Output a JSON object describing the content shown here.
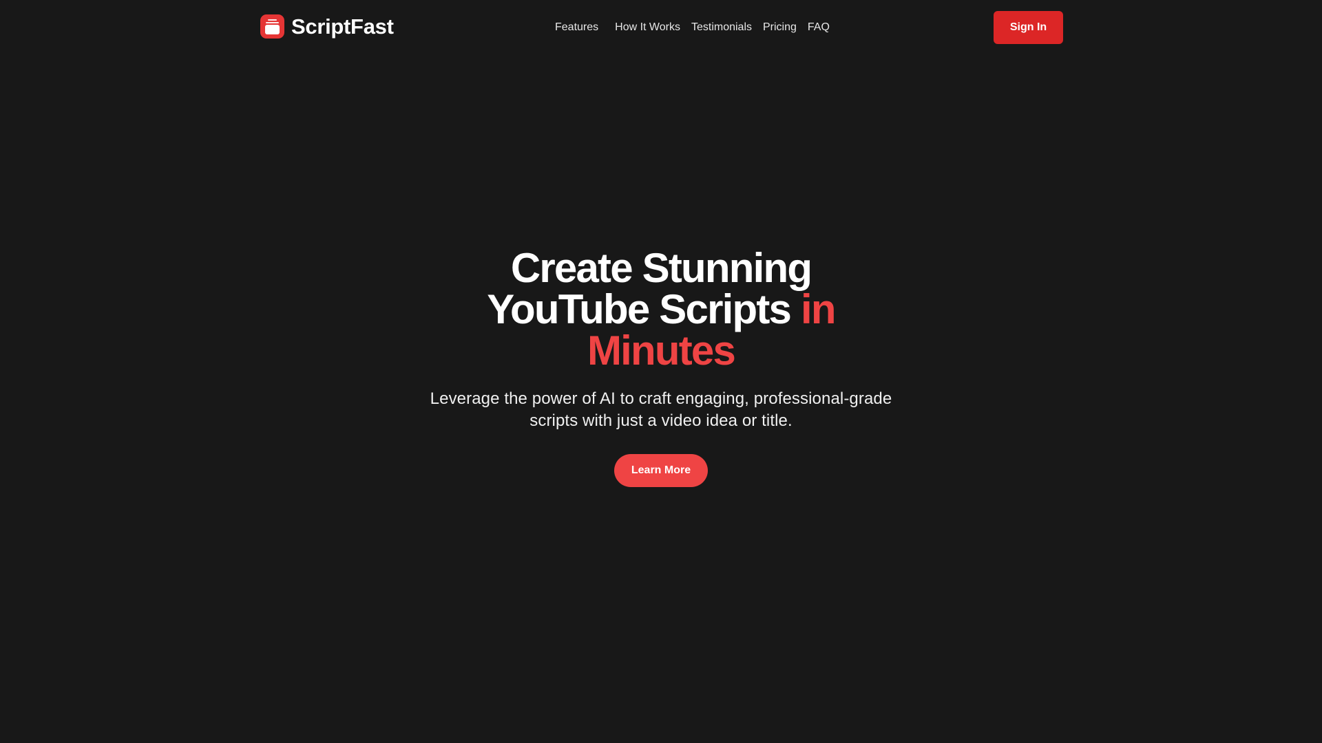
{
  "header": {
    "brand": {
      "name": "ScriptFast",
      "logo_icon": "stacked-cards-icon",
      "logo_color": "#e53535"
    },
    "nav": [
      {
        "label": "Features"
      },
      {
        "label": "How It Works"
      },
      {
        "label": "Testimonials"
      },
      {
        "label": "Pricing"
      },
      {
        "label": "FAQ"
      }
    ],
    "signin_label": "Sign In",
    "signin_color": "#dc2626"
  },
  "hero": {
    "title_main": "Create Stunning YouTube Scripts ",
    "title_accent": "in Minutes",
    "accent_color": "#ef4444",
    "subtitle": "Leverage the power of AI to craft engaging, professional-grade scripts with just a video idea or title.",
    "cta_label": "Learn More",
    "cta_color": "#ef4444"
  },
  "theme": {
    "background": "#181818",
    "text": "#ffffff"
  }
}
